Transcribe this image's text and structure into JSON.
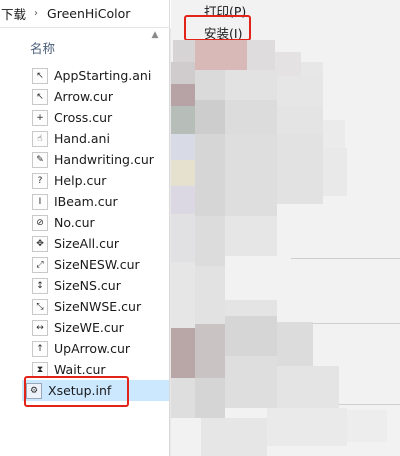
{
  "breadcrumb": {
    "items": [
      "下载",
      "GreenHiColor"
    ],
    "separator": "›"
  },
  "file_list": {
    "column_header": "名称",
    "files": [
      {
        "name": "AppStarting.ani",
        "icon": "cursor-busy-arrow-icon"
      },
      {
        "name": "Arrow.cur",
        "icon": "cursor-arrow-icon"
      },
      {
        "name": "Cross.cur",
        "icon": "cursor-cross-icon"
      },
      {
        "name": "Hand.ani",
        "icon": "cursor-hand-icon"
      },
      {
        "name": "Handwriting.cur",
        "icon": "cursor-pen-icon"
      },
      {
        "name": "Help.cur",
        "icon": "cursor-help-icon"
      },
      {
        "name": "IBeam.cur",
        "icon": "cursor-ibeam-icon"
      },
      {
        "name": "No.cur",
        "icon": "cursor-no-icon"
      },
      {
        "name": "SizeAll.cur",
        "icon": "cursor-move-icon"
      },
      {
        "name": "SizeNESW.cur",
        "icon": "cursor-resize-diagonal-icon"
      },
      {
        "name": "SizeNS.cur",
        "icon": "cursor-resize-vertical-icon"
      },
      {
        "name": "SizeNWSE.cur",
        "icon": "cursor-resize-diagonal-icon"
      },
      {
        "name": "SizeWE.cur",
        "icon": "cursor-resize-horizontal-icon"
      },
      {
        "name": "UpArrow.cur",
        "icon": "cursor-up-arrow-icon"
      },
      {
        "name": "Wait.cur",
        "icon": "cursor-wait-icon"
      },
      {
        "name": "Xsetup.inf",
        "icon": "setup-info-file-icon",
        "selected": true
      }
    ]
  },
  "context_menu": {
    "items": [
      {
        "label": "打印(P)"
      },
      {
        "label": "安装(I)"
      }
    ]
  },
  "colors": {
    "selection": "#cce8ff",
    "annotation": "#e2231a",
    "menu_background": "#f2f2f2"
  }
}
